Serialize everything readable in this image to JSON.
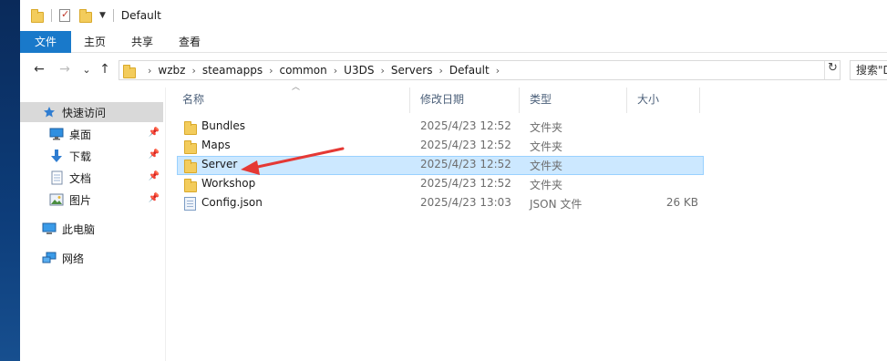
{
  "window": {
    "title": "Default",
    "quick_access_icons": [
      "folder-icon",
      "properties-icon",
      "new-folder-icon"
    ]
  },
  "ribbon": {
    "tabs": [
      "文件",
      "主页",
      "共享",
      "查看"
    ]
  },
  "navigation": {
    "back_icon": "←",
    "forward_icon": "→",
    "recent_icon": "⌄",
    "up_icon": "↑",
    "breadcrumb": [
      "wzbz",
      "steamapps",
      "common",
      "U3DS",
      "Servers",
      "Default"
    ],
    "refresh_icon": "↻",
    "search_placeholder": "搜索\"De"
  },
  "sidebar": {
    "items": [
      {
        "label": "快速访问",
        "icon": "star-icon",
        "selected": true,
        "pinned": false
      },
      {
        "label": "桌面",
        "icon": "desktop-icon",
        "selected": false,
        "pinned": true
      },
      {
        "label": "下载",
        "icon": "download-icon",
        "selected": false,
        "pinned": true
      },
      {
        "label": "文档",
        "icon": "document-icon",
        "selected": false,
        "pinned": true
      },
      {
        "label": "图片",
        "icon": "picture-icon",
        "selected": false,
        "pinned": true
      },
      {
        "label": "此电脑",
        "icon": "computer-icon",
        "selected": false,
        "pinned": false
      },
      {
        "label": "网络",
        "icon": "network-icon",
        "selected": false,
        "pinned": false
      }
    ]
  },
  "file_list": {
    "columns": [
      "名称",
      "修改日期",
      "类型",
      "大小"
    ],
    "rows": [
      {
        "name": "Bundles",
        "date": "2025/4/23 12:52",
        "type": "文件夹",
        "size": "",
        "icon": "folder-icon",
        "selected": false
      },
      {
        "name": "Maps",
        "date": "2025/4/23 12:52",
        "type": "文件夹",
        "size": "",
        "icon": "folder-icon",
        "selected": false
      },
      {
        "name": "Server",
        "date": "2025/4/23 12:52",
        "type": "文件夹",
        "size": "",
        "icon": "folder-icon",
        "selected": true
      },
      {
        "name": "Workshop",
        "date": "2025/4/23 12:52",
        "type": "文件夹",
        "size": "",
        "icon": "folder-icon",
        "selected": false
      },
      {
        "name": "Config.json",
        "date": "2025/4/23 13:03",
        "type": "JSON 文件",
        "size": "26 KB",
        "icon": "file-icon",
        "selected": false
      }
    ]
  },
  "annotation": {
    "color": "#e53935",
    "points_to": "Server"
  }
}
